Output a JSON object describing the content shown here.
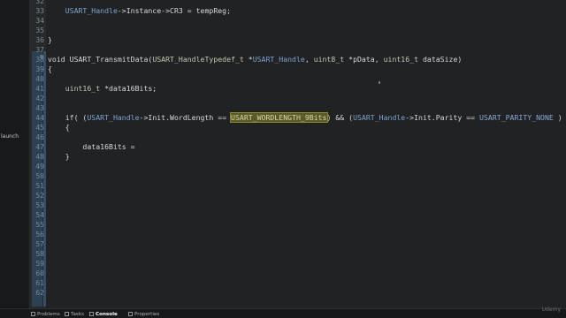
{
  "left_panel": {
    "text": "launch"
  },
  "gutter": {
    "line_numbers": [
      "32",
      "33",
      "34",
      "35",
      "36",
      "37",
      "38",
      "39",
      "40",
      "41",
      "42",
      "43",
      "44",
      "45",
      "46",
      "47",
      "48",
      "49",
      "50",
      "51",
      "52",
      "53",
      "54",
      "55",
      "56",
      "57",
      "58",
      "59",
      "60",
      "61",
      "62"
    ]
  },
  "code": {
    "lines": [
      [
        "",
        []
      ],
      [
        "    USART_Handle->Instance->CR3 = tempReg;",
        []
      ],
      [
        "",
        []
      ],
      [
        "",
        []
      ],
      [
        "}",
        []
      ],
      [
        "",
        []
      ],
      [
        "void USART_TransmitData(USART_HandleTypedef_t *USART_Handle, uint8_t *pData, uint16_t dataSize)",
        []
      ],
      [
        "{",
        []
      ],
      [
        "",
        []
      ],
      [
        "    uint16_t *data16Bits;",
        []
      ],
      [
        "",
        []
      ],
      [
        "",
        []
      ],
      [
        "    if( (USART_Handle->Init.WordLength == USART_WORDLENGTH_9Bits) && (USART_Handle->Init.Parity == USART_PARITY_NONE ) )",
        []
      ],
      [
        "    {",
        []
      ],
      [
        "",
        []
      ],
      [
        "        data16Bits =",
        []
      ],
      [
        "    }",
        []
      ]
    ]
  },
  "bottom_tabs": {
    "problems": "Problems",
    "tasks": "Tasks",
    "console": "Console",
    "properties": "Properties"
  },
  "watermark": "Udemy"
}
